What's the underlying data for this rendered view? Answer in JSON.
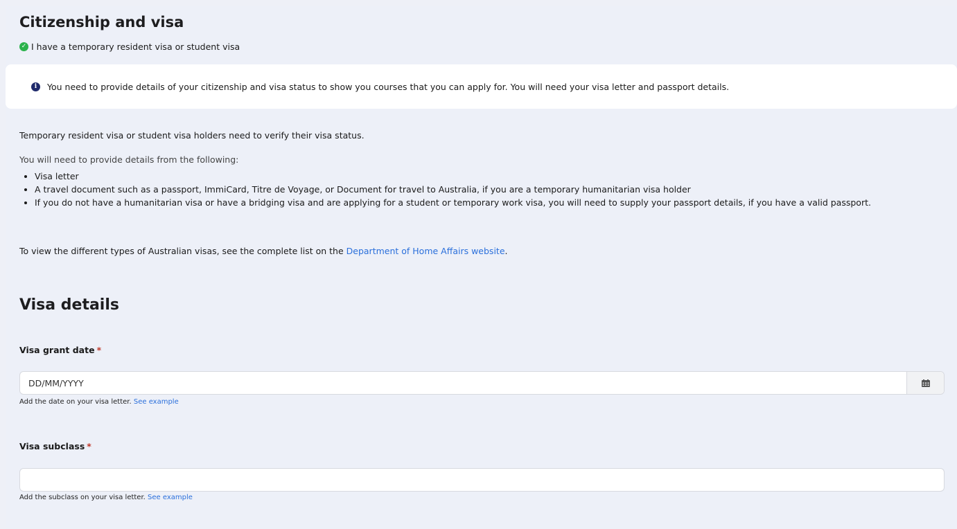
{
  "citizenship": {
    "title": "Citizenship and visa",
    "status_text": "I have a temporary resident visa or student visa",
    "status_icon": "check-circle-icon",
    "info_text": "You need to provide details of your citizenship and visa status to show you courses that you can apply for. You will need your visa letter and passport details.",
    "info_icon": "info-circle-icon",
    "p1": "Temporary resident visa or student visa holders need to verify their visa status.",
    "p2": "You will need to provide details from the following:",
    "requirements": [
      "Visa letter",
      "A travel document such as a passport, ImmiCard, Titre de Voyage, or Document for travel to Australia, if you are a temporary humanitarian visa holder",
      "If you do not have a humanitarian visa or have a bridging visa and are applying for a student or temporary work visa, you will need to supply your passport details, if you have a valid passport."
    ],
    "p3_prefix": "To view the different types of Australian visas, see the complete list on the ",
    "p3_link": "Department of Home Affairs website",
    "p3_suffix": "."
  },
  "visa_details": {
    "title": "Visa details",
    "grant_date": {
      "label": "Visa grant date",
      "required_mark": "*",
      "placeholder": "DD/MM/YYYY",
      "value": "",
      "hint": "Add the date on your visa letter.",
      "hint_link": "See example",
      "calendar_icon": "calendar-icon"
    },
    "subclass": {
      "label": "Visa subclass",
      "required_mark": "*",
      "value": "",
      "hint": "Add the subclass on your visa letter.",
      "hint_link": "See example"
    }
  },
  "colors": {
    "background": "#edf0f8",
    "link": "#2a6fdb",
    "success": "#2bb24c",
    "info": "#1f2a6b",
    "required": "#c0392b"
  }
}
